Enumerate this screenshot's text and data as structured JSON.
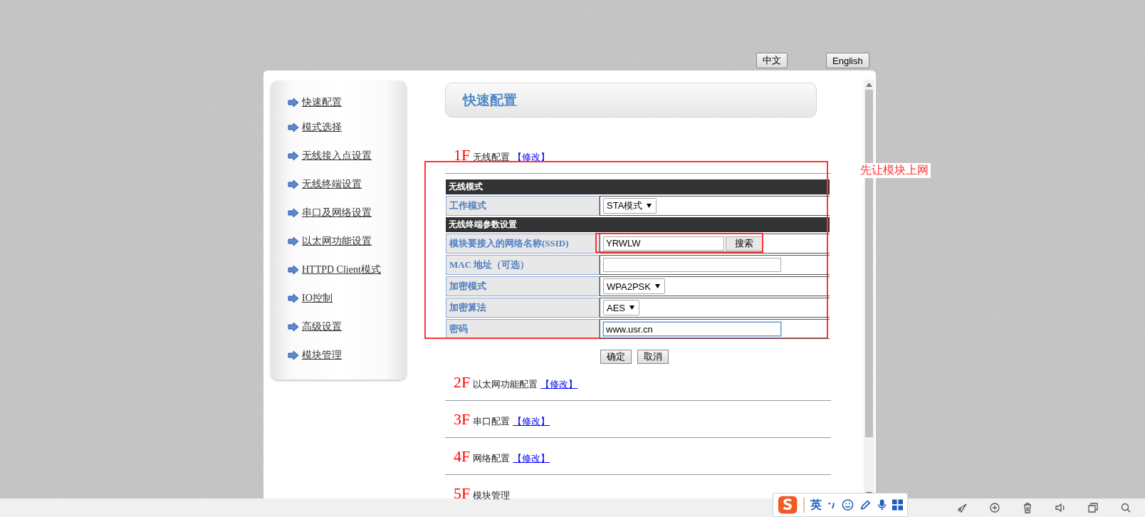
{
  "language_buttons": [
    {
      "label": "中文"
    },
    {
      "label": "English"
    }
  ],
  "sidebar": {
    "items": [
      {
        "label": "快速配置"
      },
      {
        "label": "模式选择"
      },
      {
        "label": "无线接入点设置"
      },
      {
        "label": "无线终端设置"
      },
      {
        "label": "串口及网络设置"
      },
      {
        "label": "以太网功能设置"
      },
      {
        "label": "HTTPD Client模式"
      },
      {
        "label": "IO控制"
      },
      {
        "label": "高级设置"
      },
      {
        "label": "模块管理"
      }
    ]
  },
  "header": {
    "title": "快速配置"
  },
  "sections": [
    {
      "number": "1F",
      "title": "无线配置",
      "edit_link": "【修改】",
      "expanded": true
    },
    {
      "number": "2F",
      "title": "以太网功能配置",
      "edit_link": "【修改】",
      "expanded": false
    },
    {
      "number": "3F",
      "title": "串口配置",
      "edit_link": "【修改】",
      "expanded": false
    },
    {
      "number": "4F",
      "title": "网络配置",
      "edit_link": "【修改】",
      "expanded": false
    },
    {
      "number": "5F",
      "title": "模块管理",
      "expanded": false
    }
  ],
  "form": {
    "groups": [
      {
        "heading": "无线模式",
        "rows": [
          {
            "label": "工作模式",
            "kind": "select",
            "value": "STA模式"
          }
        ]
      },
      {
        "heading": "无线终端参数设置",
        "rows": [
          {
            "label": "模块要接入的网络名称(SSID)",
            "kind": "text_with_button",
            "value": "YRWLW",
            "button": "搜索",
            "highlighted": true,
            "focused": false
          },
          {
            "label": "MAC 地址（可选）",
            "kind": "text",
            "focused": false
          },
          {
            "label": "加密模式",
            "kind": "select",
            "value": "WPA2PSK"
          },
          {
            "label": "加密算法",
            "kind": "select",
            "value": "AES"
          },
          {
            "label": "密码",
            "kind": "text",
            "value": "www.usr.cn",
            "focused": true
          }
        ]
      }
    ],
    "buttons": [
      {
        "label": "确定"
      },
      {
        "label": "取消"
      }
    ],
    "annotation": "先让模块上网"
  },
  "ime_toolbar": {
    "mode": "英"
  }
}
